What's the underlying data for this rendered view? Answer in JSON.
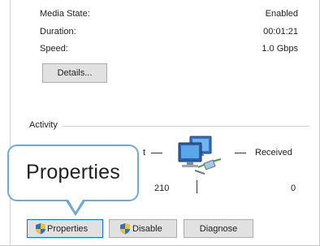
{
  "details": {
    "media_state_label": "Media State:",
    "media_state_value": "Enabled",
    "duration_label": "Duration:",
    "duration_value": "00:01:21",
    "speed_label": "Speed:",
    "speed_value": "1.0 Gbps",
    "details_button": "Details..."
  },
  "activity": {
    "label": "Activity",
    "sent_partial": "t",
    "received_label": "Received",
    "sent_value": "210",
    "received_value": "0"
  },
  "callout": {
    "text": "Properties"
  },
  "buttons": {
    "properties": "Properties",
    "disable": "Disable",
    "diagnose": "Diagnose"
  },
  "colors": {
    "callout_border": "#6fa9d8",
    "button_face": "#e1e1e1",
    "focus_border": "#0078d7"
  },
  "icons": {
    "network": "network-computers-icon",
    "shield": "uac-shield-icon"
  }
}
